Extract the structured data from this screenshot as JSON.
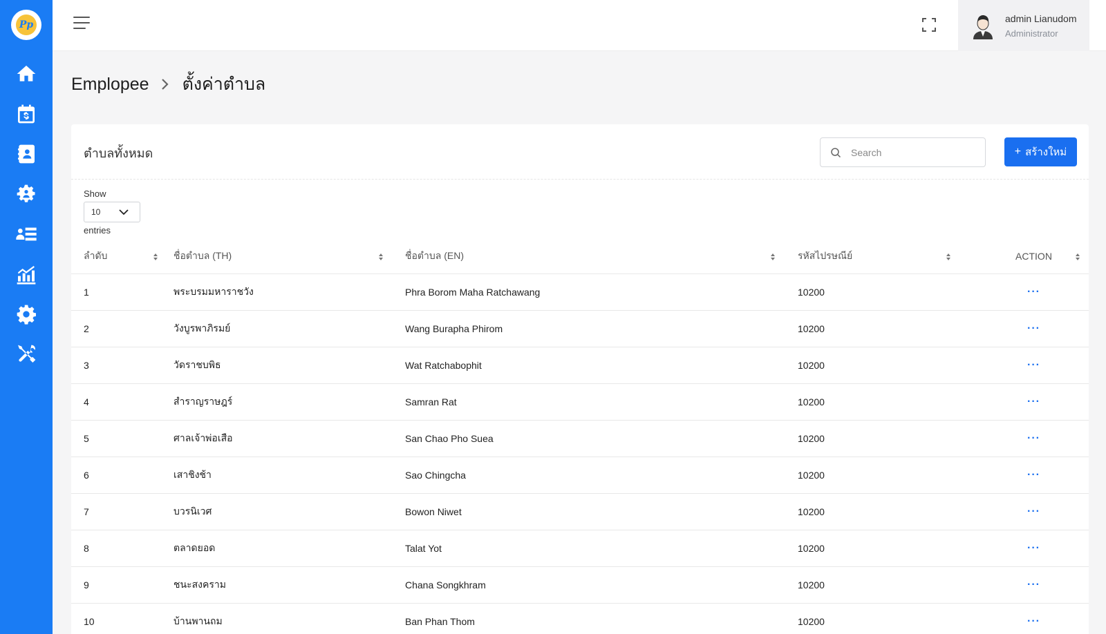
{
  "sidebar": {
    "logo_text": "Pp",
    "items": [
      {
        "icon": "home-icon"
      },
      {
        "icon": "calendar-dollar-icon"
      },
      {
        "icon": "contacts-icon"
      },
      {
        "icon": "team-gear-icon"
      },
      {
        "icon": "user-list-icon"
      },
      {
        "icon": "chart-icon"
      },
      {
        "icon": "gear-icon"
      },
      {
        "icon": "tools-icon"
      }
    ],
    "color": "#1a7cf4"
  },
  "topbar": {
    "user_name": "admin Lianudom",
    "user_role": "Administrator"
  },
  "breadcrumb": {
    "parent": "Emplopee",
    "current": "ตั้งค่าตำบล"
  },
  "card": {
    "title": "ตำบลทั้งหมด",
    "search_placeholder": "Search",
    "create_label": "สร้างใหม่",
    "show_label": "Show",
    "page_length": "10",
    "entries_label": "entries"
  },
  "table": {
    "headers": [
      "ลำดับ",
      "ชื่อตำบล (TH)",
      "ชื่อตำบล (EN)",
      "รหัสไปรษณีย์",
      "ACTION"
    ],
    "action_glyph": "···",
    "rows": [
      {
        "no": "1",
        "th": "พระบรมมหาราชวัง",
        "en": "Phra Borom Maha Ratchawang",
        "zip": "10200"
      },
      {
        "no": "2",
        "th": "วังบูรพาภิรมย์",
        "en": "Wang Burapha Phirom",
        "zip": "10200"
      },
      {
        "no": "3",
        "th": "วัดราชบพิธ",
        "en": "Wat Ratchabophit",
        "zip": "10200"
      },
      {
        "no": "4",
        "th": "สำราญราษฎร์",
        "en": "Samran Rat",
        "zip": "10200"
      },
      {
        "no": "5",
        "th": "ศาลเจ้าพ่อเสือ",
        "en": "San Chao Pho Suea",
        "zip": "10200"
      },
      {
        "no": "6",
        "th": "เสาชิงช้า",
        "en": "Sao Chingcha",
        "zip": "10200"
      },
      {
        "no": "7",
        "th": "บวรนิเวศ",
        "en": "Bowon Niwet",
        "zip": "10200"
      },
      {
        "no": "8",
        "th": "ตลาดยอด",
        "en": "Talat Yot",
        "zip": "10200"
      },
      {
        "no": "9",
        "th": "ชนะสงคราม",
        "en": "Chana Songkhram",
        "zip": "10200"
      },
      {
        "no": "10",
        "th": "บ้านพานถม",
        "en": "Ban Phan Thom",
        "zip": "10200"
      }
    ]
  },
  "colors": {
    "accent": "#1a6ff0",
    "background": "#f5f5f6"
  }
}
